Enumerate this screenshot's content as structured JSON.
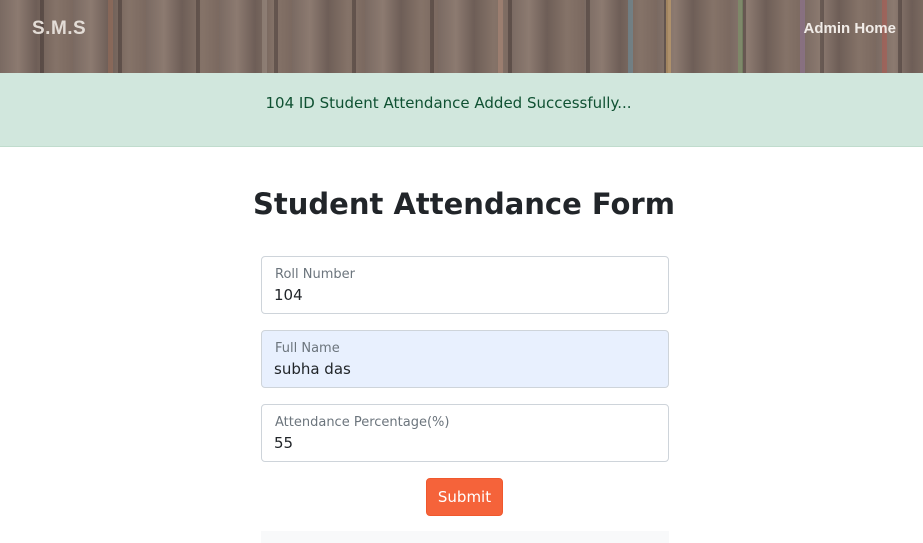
{
  "navbar": {
    "brand": "S.M.S",
    "admin_link": "Admin Home",
    "background": "bookshelf-image"
  },
  "alert": {
    "message": "104 ID Student Attendance Added Successfully...",
    "type": "success"
  },
  "form": {
    "title": "Student Attendance Form",
    "fields": [
      {
        "label": "Roll Number",
        "value": "104"
      },
      {
        "label": "Full Name",
        "value": "subha das"
      },
      {
        "label": "Attendance Percentage(%)",
        "value": "55"
      }
    ],
    "submit_label": "Submit"
  },
  "colors": {
    "alert_bg": "#d1e7dd",
    "alert_text": "#0f5132",
    "submit_bg": "#f5633a",
    "autofill_bg": "#e8f0fe"
  }
}
